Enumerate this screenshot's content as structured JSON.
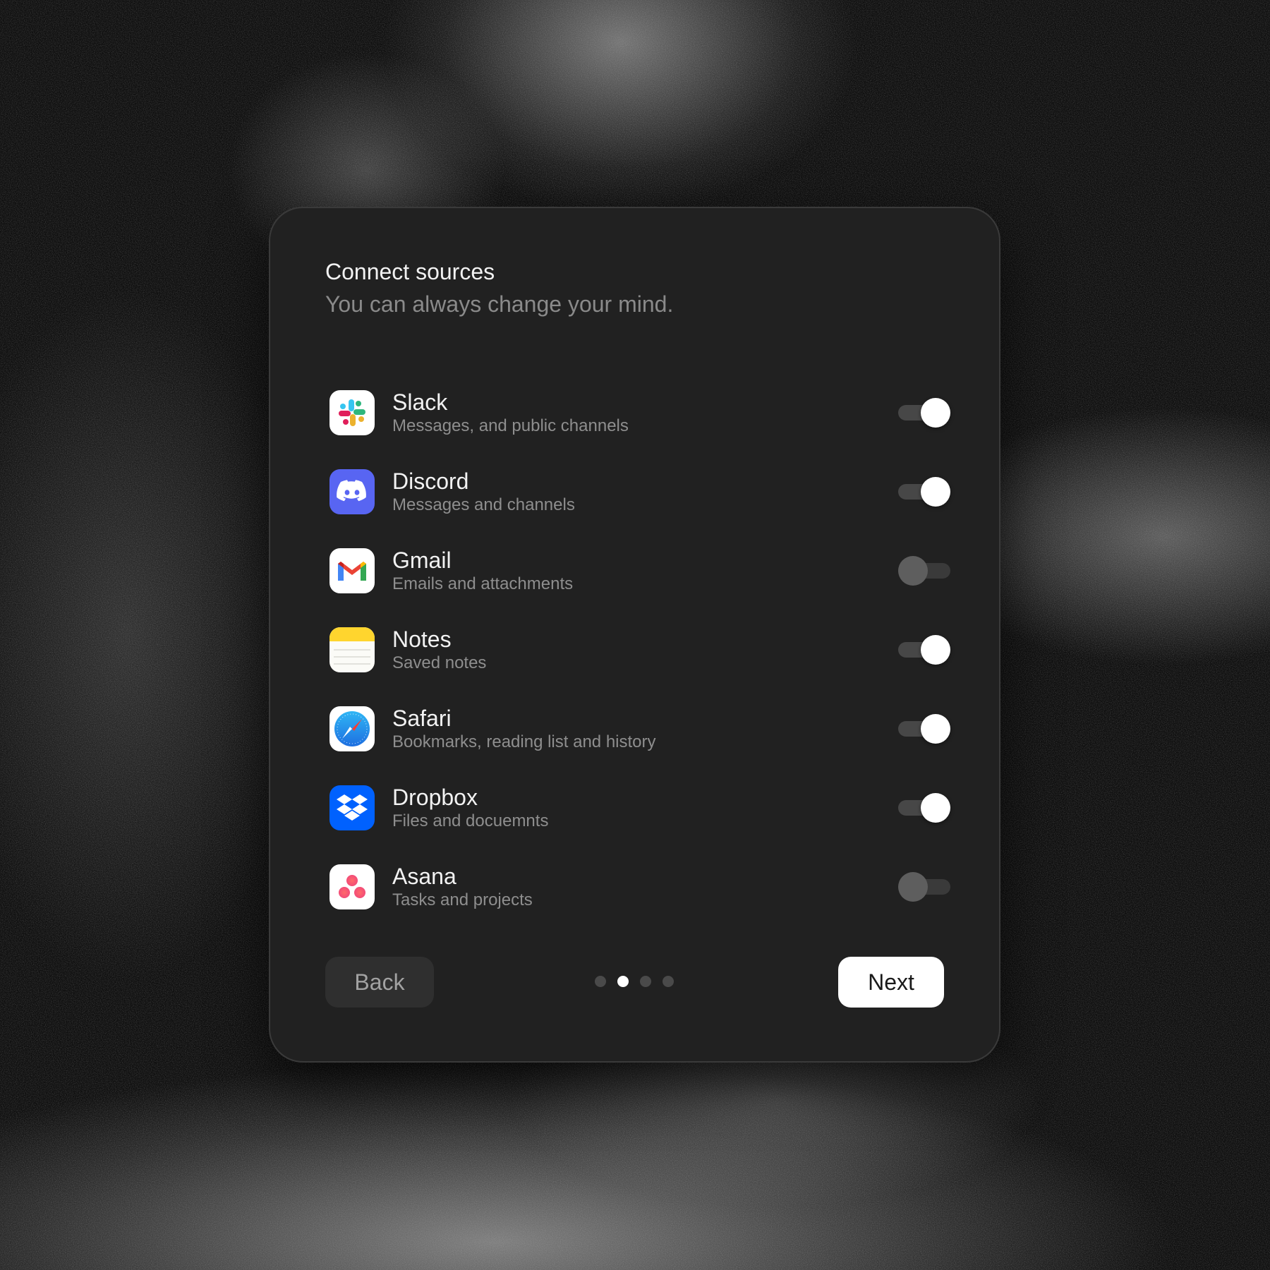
{
  "dialog": {
    "title": "Connect sources",
    "subtitle": "You can always change your mind."
  },
  "sources": [
    {
      "name": "Slack",
      "description": "Messages, and public channels",
      "enabled": true,
      "icon": "slack-icon"
    },
    {
      "name": "Discord",
      "description": "Messages and channels",
      "enabled": true,
      "icon": "discord-icon"
    },
    {
      "name": "Gmail",
      "description": "Emails and attachments",
      "enabled": false,
      "icon": "gmail-icon"
    },
    {
      "name": "Notes",
      "description": "Saved notes",
      "enabled": true,
      "icon": "notes-icon"
    },
    {
      "name": "Safari",
      "description": "Bookmarks, reading list and history",
      "enabled": true,
      "icon": "safari-icon"
    },
    {
      "name": "Dropbox",
      "description": "Files and docuemnts",
      "enabled": true,
      "icon": "dropbox-icon"
    },
    {
      "name": "Asana",
      "description": "Tasks and projects",
      "enabled": false,
      "icon": "asana-icon"
    }
  ],
  "footer": {
    "back_label": "Back",
    "next_label": "Next",
    "page_count": 4,
    "current_page": 2
  },
  "colors": {
    "dialog_bg": "#212121",
    "toggle_on_knob": "#ffffff",
    "toggle_off_knob": "#5e5e5e",
    "discord": "#5865F2",
    "dropbox": "#0061FE",
    "notes_yellow": "#FFD52E"
  }
}
